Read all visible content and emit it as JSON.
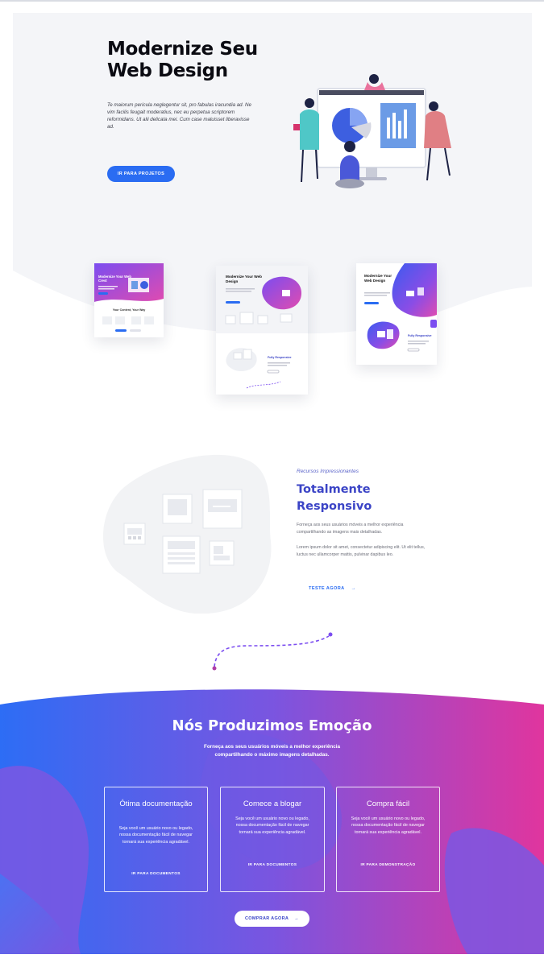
{
  "hero": {
    "title_line1": "Modernize Seu",
    "title_line2": "Web Design",
    "text": "Te maiorum pericula neglegentur sit, pro fabulas iracundia ad. Ne vim facilis feugait moderatius, nec eu perpetua scriptorem reformidans. Ut alii delicata mei. Cum case maluisset liberavisse ad.",
    "button_label": "IR PARA PROJETOS"
  },
  "mockups": {
    "mock1_title": "Modernize Your Web Crest",
    "mock1_section": "Your Content, Your Way",
    "mock2_title": "Modernize Your Web Design",
    "mock2_feature": "Fully Responsive",
    "mock3_title": "Modernize Your Web Design",
    "mock3_feature": "Fully Responsive"
  },
  "feature": {
    "eyebrow": "Recursos Impressionantes",
    "title_line1": "Totalmente",
    "title_line2": "Responsivo",
    "p1": "Forneça aos seus usuários móveis a melhor experiência compartilhando as imagens mais detalhadas.",
    "p2": "Lorem ipsum dolor sit amet, consectetur adipiscing elit. Ut elit tellus, luctus nec ullamcorper mattis, pulvinar dapibus leo.",
    "link_label": "TESTE AGORA",
    "link_arrow": "→"
  },
  "emotion": {
    "title": "Nós Produzimos Emoção",
    "subtitle": "Forneça aos seus usuários móveis a melhor experiência compartilhando o máximo imagens detalhadas.",
    "cards": [
      {
        "title": "Ótima documentação",
        "text": "Seja você um usuário novo ou legado, nossa documentação fácil de navegar tornará sua experiência agradável.",
        "link": "IR PARA DOCUMENTOS"
      },
      {
        "title": "Comece a blogar",
        "text": "Seja você um usuário novo ou legado, nossa documentação fácil de navegar tornará sua experiência agradável.",
        "link": "IR PARA DOCUMENTOS"
      },
      {
        "title": "Compra fácil",
        "text": "Seja você um usuário novo ou legado, nossa documentação fácil de navegar tornará sua experiência agradável.",
        "link": "IR PARA DEMONSTRAÇÃO"
      }
    ],
    "button_label": "COMPRAR AGORA",
    "button_arrow": "→"
  },
  "colors": {
    "primary_blue": "#2a6cf2",
    "heading_purple": "#3b44c6",
    "gradient_start": "#2d6df5",
    "gradient_mid": "#7a55e0",
    "gradient_end": "#e0359e"
  }
}
